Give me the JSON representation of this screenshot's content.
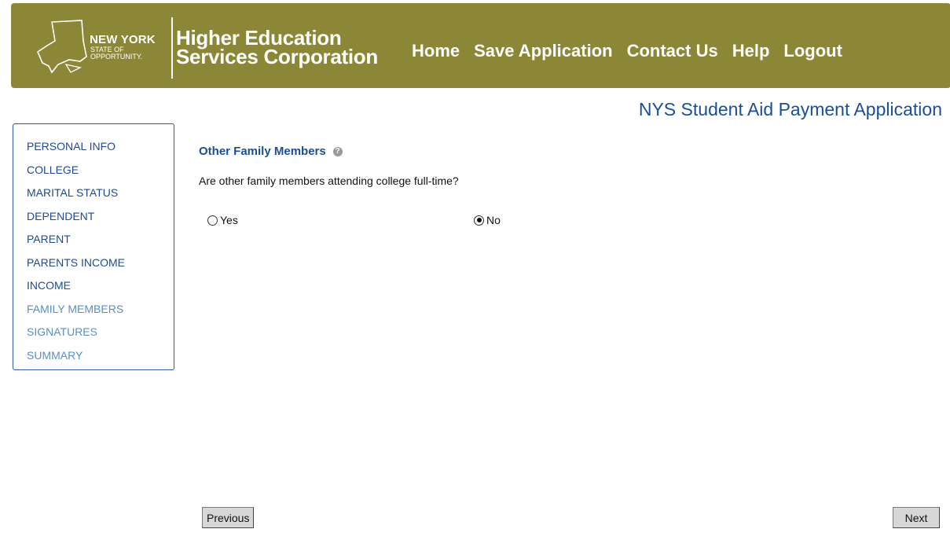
{
  "header": {
    "logo_title": "NEW YORK",
    "logo_subtitle_1": "STATE OF",
    "logo_subtitle_2": "OPPORTUNITY.",
    "org_line_1": "Higher Education",
    "org_line_2": "Services Corporation",
    "background_color": "#8c8736",
    "nav": [
      {
        "label": "Home"
      },
      {
        "label": "Save Application"
      },
      {
        "label": "Contact Us"
      },
      {
        "label": "Help"
      },
      {
        "label": "Logout"
      }
    ]
  },
  "app_title": "NYS Student Aid Payment Application",
  "sidebar": {
    "items": [
      {
        "label": "PERSONAL INFO",
        "state": "completed"
      },
      {
        "label": "COLLEGE",
        "state": "completed"
      },
      {
        "label": "MARITAL STATUS",
        "state": "completed"
      },
      {
        "label": "DEPENDENT",
        "state": "completed"
      },
      {
        "label": "PARENT",
        "state": "completed"
      },
      {
        "label": "PARENTS INCOME",
        "state": "completed"
      },
      {
        "label": "INCOME",
        "state": "completed"
      },
      {
        "label": "FAMILY MEMBERS",
        "state": "current"
      },
      {
        "label": "SIGNATURES",
        "state": "pending"
      },
      {
        "label": "SUMMARY",
        "state": "pending"
      }
    ]
  },
  "main": {
    "section_title": "Other Family Members",
    "help_icon": "question-circle-icon",
    "question": "Are other family members attending college full-time?",
    "options": [
      {
        "label": "Yes",
        "selected": false
      },
      {
        "label": "No",
        "selected": true
      }
    ]
  },
  "footer": {
    "previous_label": "Previous",
    "next_label": "Next"
  }
}
